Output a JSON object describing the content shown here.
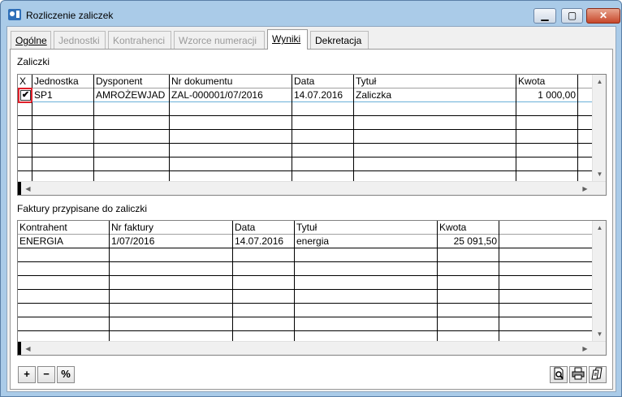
{
  "window": {
    "title": "Rozliczenie zaliczek"
  },
  "tabs": [
    {
      "label": "Ogólne",
      "state": "normal"
    },
    {
      "label": "Jednostki",
      "state": "disabled"
    },
    {
      "label": "Kontrahenci",
      "state": "disabled"
    },
    {
      "label": "Wzorce numeracji",
      "state": "disabled"
    },
    {
      "label": "Wyniki",
      "state": "active"
    },
    {
      "label": "Dekretacja",
      "state": "normal"
    }
  ],
  "advances": {
    "label": "Zaliczki",
    "columns": [
      "X",
      "Jednostka",
      "Dysponent",
      "Nr dokumentu",
      "Data",
      "Tytuł",
      "Kwota"
    ],
    "rows": [
      {
        "checked": true,
        "jednostka": "SP1",
        "dysponent": "AMROŻEWJAD",
        "nr_dokumentu": "ZAL-000001/07/2016",
        "data": "14.07.2016",
        "tytul": "Zaliczka",
        "kwota": "1 000,00"
      }
    ]
  },
  "invoices": {
    "label": "Faktury przypisane do zaliczki",
    "columns": [
      "Kontrahent",
      "Nr faktury",
      "Data",
      "Tytuł",
      "Kwota"
    ],
    "rows": [
      {
        "kontrahent": "ENERGIA",
        "nr_faktury": "1/07/2016",
        "data": "14.07.2016",
        "tytul": "energia",
        "kwota": "25 091,50"
      }
    ]
  },
  "toolbar": {
    "add": "+",
    "remove": "−",
    "percent": "%"
  },
  "colors": {
    "selection_outline": "#e0202a",
    "title_bg": "#aacbe8"
  }
}
